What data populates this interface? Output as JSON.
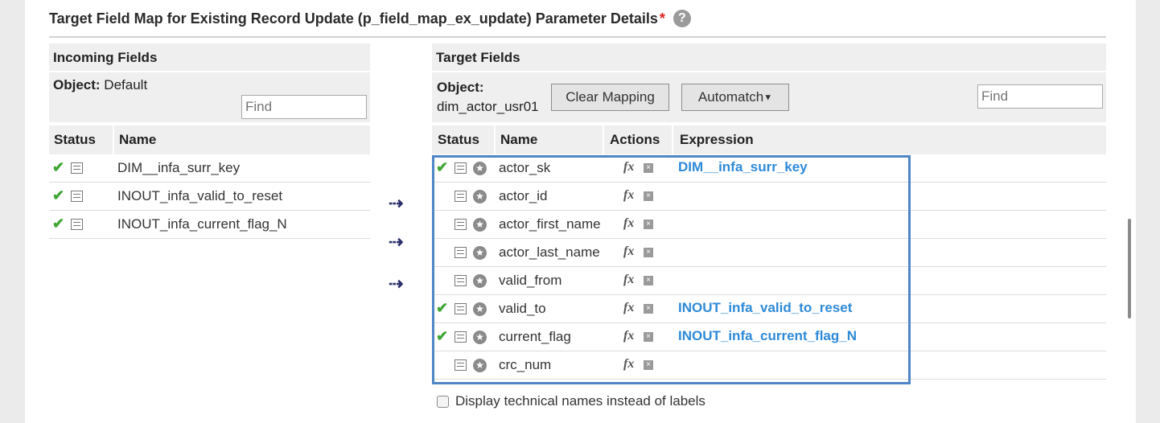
{
  "header": {
    "title": "Target Field Map for Existing Record Update (p_field_map_ex_update) Parameter Details",
    "required_mark": "*",
    "help_icon": "?"
  },
  "incoming": {
    "title": "Incoming Fields",
    "object_label": "Object:",
    "object_value": "Default",
    "find_placeholder": "Find",
    "columns": {
      "status": "Status",
      "name": "Name"
    },
    "rows": [
      {
        "name": "DIM__infa_surr_key",
        "mapped": true
      },
      {
        "name": "INOUT_infa_valid_to_reset",
        "mapped": true
      },
      {
        "name": "INOUT_infa_current_flag_N",
        "mapped": true
      }
    ]
  },
  "arrows": [
    "⇢",
    "⇢",
    "⇢"
  ],
  "target": {
    "title": "Target Fields",
    "object_label": "Object:",
    "object_value": "dim_actor_usr01",
    "clear_mapping_label": "Clear Mapping",
    "automatch_label": "Automatch",
    "find_placeholder": "Find",
    "columns": {
      "status": "Status",
      "name": "Name",
      "actions": "Actions",
      "expression": "Expression"
    },
    "action_fx": "fx",
    "action_clear": "×",
    "rows": [
      {
        "name": "actor_sk",
        "mapped": true,
        "expression": "DIM__infa_surr_key"
      },
      {
        "name": "actor_id",
        "mapped": false,
        "expression": ""
      },
      {
        "name": "actor_first_name",
        "mapped": false,
        "expression": ""
      },
      {
        "name": "actor_last_name",
        "mapped": false,
        "expression": ""
      },
      {
        "name": "valid_from",
        "mapped": false,
        "expression": ""
      },
      {
        "name": "valid_to",
        "mapped": true,
        "expression": "INOUT_infa_valid_to_reset"
      },
      {
        "name": "current_flag",
        "mapped": true,
        "expression": "INOUT_infa_current_flag_N"
      },
      {
        "name": "crc_num",
        "mapped": false,
        "expression": ""
      }
    ]
  },
  "display_technical_names_label": "Display technical names instead of labels",
  "colors": {
    "accent": "#2e8ad8",
    "check": "#3fa535",
    "highlight": "#4f86c6"
  }
}
